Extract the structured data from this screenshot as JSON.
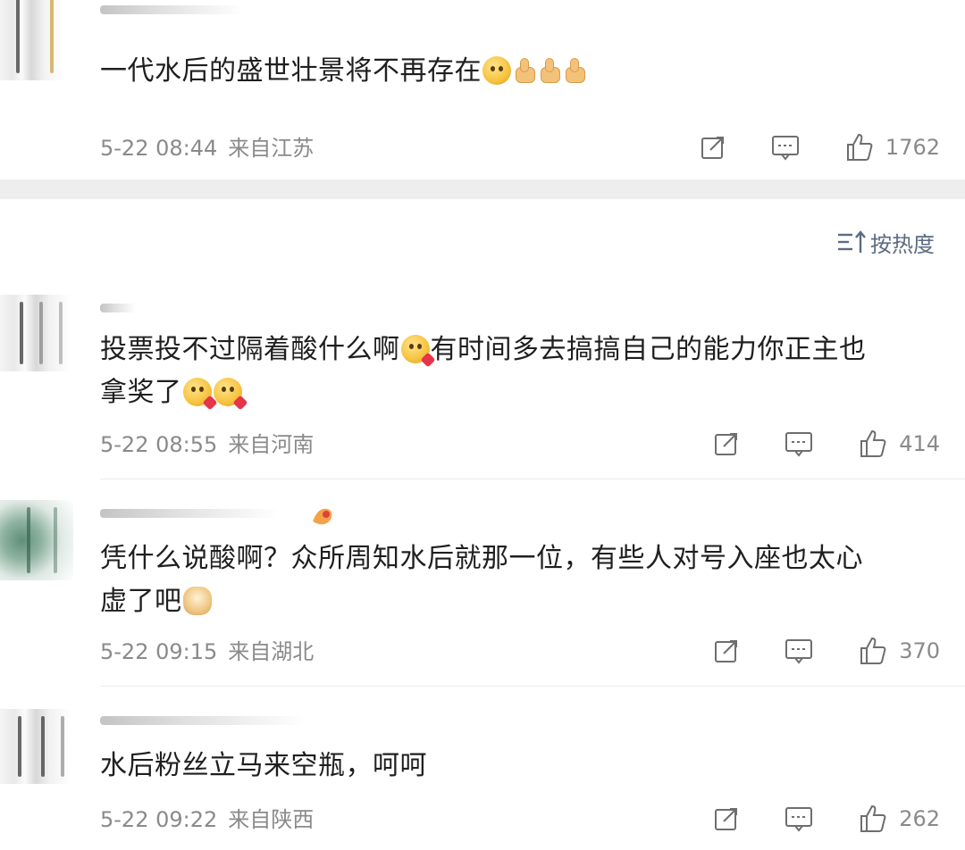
{
  "sort": {
    "label": "按热度"
  },
  "comments": [
    {
      "text": "一代水后的盛世壮景将不再存在",
      "emojis": [
        "face-icon",
        "thumbs-up-icon",
        "thumbs-up-icon",
        "thumbs-up-icon"
      ],
      "time": "5-22 08:44",
      "location": "来自江苏",
      "likes": "1762"
    },
    {
      "text_line1": "投票投不过隔着酸什么啊",
      "text_line1_b": "有时间多去搞搞自己的能力你正主也",
      "text_line2": "拿奖了",
      "time": "5-22 08:55",
      "location": "来自河南",
      "likes": "414"
    },
    {
      "text_line1": "凭什么说酸啊？众所周知水后就那一位，有些人对号入座也太心",
      "text_line2": "虚了吧",
      "time": "5-22 09:15",
      "location": "来自湖北",
      "likes": "370"
    },
    {
      "text": "水后粉丝立马来空瓶，呵呵",
      "time": "5-22 09:22",
      "location": "来自陕西",
      "likes": "262"
    }
  ],
  "colors": {
    "text": "#1f1f1f",
    "meta": "#8a8a8a",
    "sort": "#5b6b82",
    "band": "#eeeeee"
  }
}
